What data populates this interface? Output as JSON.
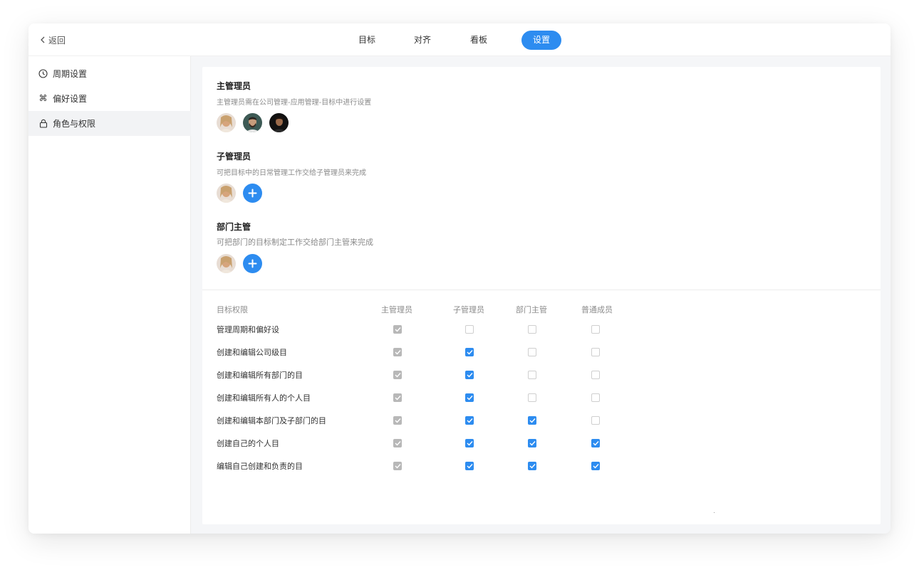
{
  "topbar": {
    "back_label": "返回",
    "tabs": [
      {
        "label": "目标",
        "active": false
      },
      {
        "label": "对齐",
        "active": false
      },
      {
        "label": "看板",
        "active": false
      },
      {
        "label": "设置",
        "active": true
      }
    ]
  },
  "sidebar": {
    "items": [
      {
        "label": "周期设置",
        "icon": "clock-icon",
        "active": false
      },
      {
        "label": "偏好设置",
        "icon": "command-icon",
        "active": false
      },
      {
        "label": "角色与权限",
        "icon": "lock-icon",
        "active": true
      }
    ]
  },
  "roles": {
    "admin": {
      "title": "主管理员",
      "desc": "主管理员需在公司管理-应用管理-目标中进行设置",
      "avatar_count": 3
    },
    "sub_admin": {
      "title": "子管理员",
      "desc": "可把目标中的日常管理工作交给子管理员来完成",
      "avatar_count": 1
    },
    "dept_head": {
      "title": "部门主管",
      "desc": "可把部门的目标制定工作交给部门主管来完成",
      "avatar_count": 1
    }
  },
  "permissions": {
    "headers": [
      "目标权限",
      "主管理员",
      "子管理员",
      "部门主管",
      "普通成员"
    ],
    "rows": [
      {
        "label": "管理周期和偏好设",
        "checks": [
          "locked",
          false,
          false,
          false
        ]
      },
      {
        "label": "创建和编辑公司级目",
        "checks": [
          "locked",
          true,
          false,
          false
        ]
      },
      {
        "label": "创建和编辑所有部门的目",
        "checks": [
          "locked",
          true,
          false,
          false
        ]
      },
      {
        "label": "创建和编辑所有人的个人目",
        "checks": [
          "locked",
          true,
          false,
          false
        ]
      },
      {
        "label": "创建和编辑本部门及子部门的目",
        "checks": [
          "locked",
          true,
          true,
          false
        ]
      },
      {
        "label": "创建自己的个人目",
        "checks": [
          "locked",
          true,
          true,
          true
        ]
      },
      {
        "label": "编辑自己创建和负责的目",
        "checks": [
          "locked",
          true,
          true,
          true
        ]
      }
    ]
  },
  "colors": {
    "accent": "#2d8cf0",
    "locked": "#b8b8b8",
    "sidebar_active": "#f2f3f5"
  }
}
